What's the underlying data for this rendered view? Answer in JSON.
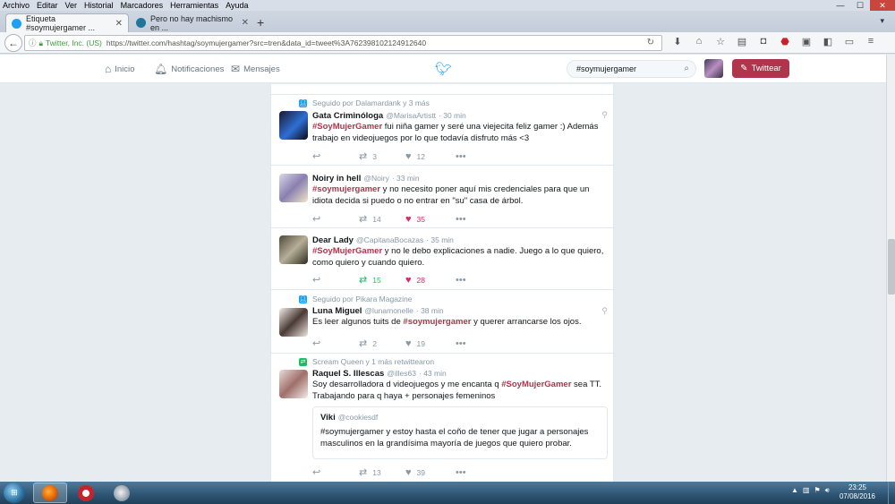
{
  "browser": {
    "menu": [
      "Archivo",
      "Editar",
      "Ver",
      "Historial",
      "Marcadores",
      "Herramientas",
      "Ayuda"
    ],
    "window_buttons": {
      "minimize": "—",
      "maximize": "☐",
      "close": "✕"
    },
    "tabs": [
      {
        "title": "Etiqueta #soymujergamer ...",
        "active": true,
        "favicon_color": "#1da1f2"
      },
      {
        "title": "Pero no hay machismo en ...",
        "active": false,
        "favicon_color": "#21759b"
      }
    ],
    "new_tab": "+",
    "address": {
      "org": "Twitter, Inc. (US)",
      "url": "https://twitter.com/hashtag/soymujergamer?src=tren&data_id=tweet%3A762398102124912640"
    }
  },
  "twitter": {
    "nav": {
      "home": "Inicio",
      "notifications": "Notificaciones",
      "messages": "Mensajes"
    },
    "search_value": "#soymujergamer",
    "tweet_button": "Twittear",
    "tweets": [
      {
        "context": "Seguido por Dalamardank y 3 más",
        "context_color": "#1da1f2",
        "name": "Gata Criminóloga",
        "handle": "@MarisaArtistt",
        "time": "· 30 min",
        "hashtag": "#SoyMujerGamer",
        "text_after_tag": " fui niña gamer y seré una viejecita feliz gamer :)  Además trabajo en videojuegos por lo que todavía disfruto más <3",
        "retweets": "3",
        "likes": "12",
        "avatar": [
          "#1a1a2e",
          "#2e6fd4",
          "#0a0a14"
        ]
      },
      {
        "name": "Noiry in hell",
        "handle": "@Noiry",
        "time": "· 33 min",
        "hashtag": "#soymujergamer",
        "text_after_tag": " y no necesito poner aquí mis credenciales para que un idiota decida si puedo o no entrar en \"su\" casa de árbol.",
        "retweets": "14",
        "likes": "35",
        "avatar": [
          "#d8d8e6",
          "#8a7fb0",
          "#f1e6c8"
        ]
      },
      {
        "name": "Dear Lady",
        "handle": "@CapitanaBocazas",
        "time": "· 35 min",
        "hashtag": "#SoyMujerGamer",
        "text_after_tag": " y no le debo explicaciones a nadie. Juego a lo que quiero, como quiero y cuando quiero.",
        "retweets": "15",
        "likes": "28",
        "avatar": [
          "#4e4a3a",
          "#b6ae96",
          "#2f2c22"
        ]
      },
      {
        "context": "Seguido por Pikara Magazine",
        "context_color": "#1da1f2",
        "name": "Luna Miguel",
        "handle": "@lunamonelle",
        "time": "· 38 min",
        "text_before_tag": "Es leer algunos tuits de ",
        "hashtag": "#soymujergamer",
        "text_after_tag": " y querer arrancarse los ojos.",
        "retweets": "2",
        "likes": "19",
        "avatar": [
          "#f2ece8",
          "#4a3a35",
          "#efe6e0"
        ]
      },
      {
        "context": "Scream Queen y 1 más retwittearon",
        "context_color": "#17bf63",
        "name": "Raquel S. Illescas",
        "handle": "@illes63",
        "time": "· 43 min",
        "text_before_tag": "Soy desarrolladora d videojuegos y me encanta q ",
        "hashtag": "#SoyMujerGamer",
        "text_after_tag": " sea TT. Trabajando para q haya + personajes femeninos",
        "quote": {
          "name": "Viki",
          "handle": "@cookiesdf",
          "text": "#soymujergamer y estoy hasta el coño de tener que jugar a personajes masculinos en la grandísima mayoría de juegos que quiero probar."
        },
        "retweets": "13",
        "likes": "39",
        "avatar": [
          "#e9dcd8",
          "#a06f6a",
          "#f3ebe8"
        ]
      }
    ]
  },
  "taskbar": {
    "clock_time": "23:25",
    "clock_date": "07/08/2016"
  },
  "icons": [
    "back-icon",
    "info-icon",
    "lock-icon",
    "reload-icon",
    "download-icon",
    "home-icon",
    "star-icon",
    "reading-list-icon",
    "pocket-icon",
    "adblock-icon",
    "screenshot-icon",
    "extension-icon",
    "menu-icon",
    "twitter-home-icon",
    "bell-icon",
    "envelope-icon",
    "twitter-bird-icon",
    "search-icon",
    "feather-icon",
    "reply-icon",
    "retweet-icon",
    "heart-icon",
    "more-icon",
    "location-icon",
    "windows-start-icon",
    "firefox-icon",
    "vlc-icon",
    "paint-icon"
  ]
}
